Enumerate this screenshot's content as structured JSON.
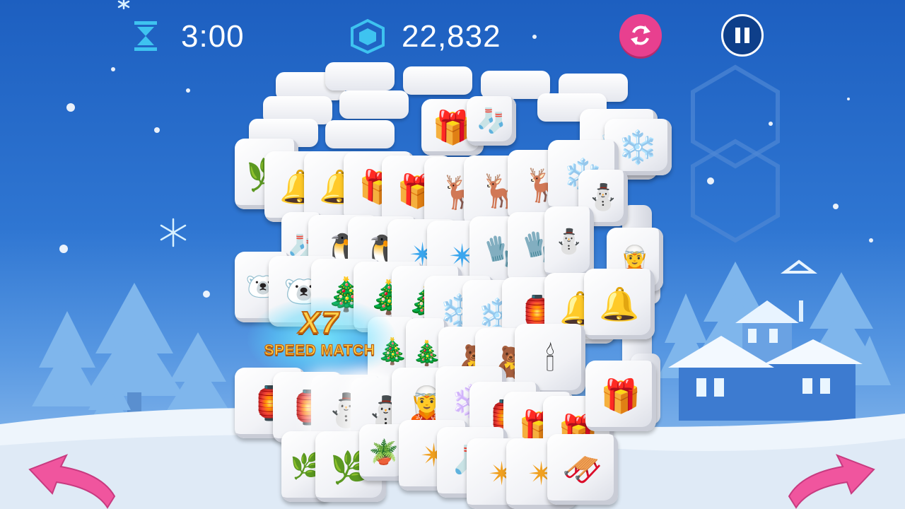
{
  "hud": {
    "timer": "3:00",
    "score": "22,832",
    "timer_icon": "hourglass-icon",
    "score_icon": "cube-icon",
    "refresh_icon": "shuffle-icon",
    "pause_icon": "pause-icon"
  },
  "combo": {
    "multiplier": "X7",
    "label": "SPEED MATCH"
  },
  "colors": {
    "accent_pink": "#e8408f",
    "pause_navy": "#0e3f8a",
    "combo_gold": "#ffd24a",
    "sky_blue": "#2f76d2"
  },
  "tiles": {
    "row1": [
      "🌿",
      "🔔",
      "🔔",
      "🎁",
      "🎁",
      "🦌",
      "🦌",
      "🦌",
      "❄️",
      "⛄"
    ],
    "row2": [
      "🧦",
      "🐧",
      "🐧",
      "✴",
      "✴",
      "🧤",
      "🧤",
      "⛄",
      "🧝"
    ],
    "row3": [
      "🐻‍❄️",
      "🐻‍❄️",
      "🎄",
      "🎄",
      "🎄",
      "❄️",
      "❄️",
      "🏮",
      "🔔",
      "🔔"
    ],
    "row4": [
      "🎄",
      "🎄",
      "🧸",
      "🧸",
      "🕯"
    ],
    "row5": [
      "🏮",
      "🏮",
      "⛄",
      "⛄",
      "🧝",
      "❄️",
      "🏮",
      "🎁",
      "🎁",
      "🎁"
    ],
    "row6": [
      "🌿",
      "🌿",
      "🪴",
      "✴",
      "🧦",
      "✴",
      "✴",
      "🛷"
    ],
    "top": [
      "🎁",
      "🧦",
      "❄️",
      "❄️"
    ]
  }
}
